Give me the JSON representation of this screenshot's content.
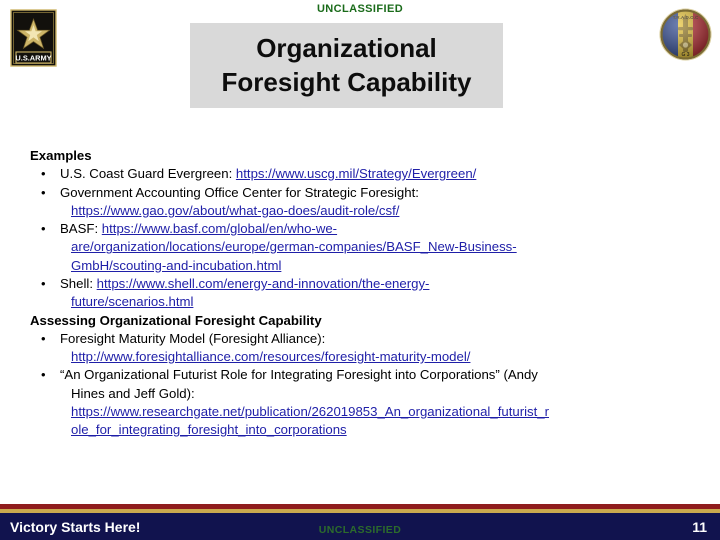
{
  "classification": {
    "top_label": "UNCLASSIFIED",
    "bottom_label": "UNCLASSIFIED",
    "color": "#1a6b1a"
  },
  "logos": {
    "army_star": {
      "name": "us-army-star-logo",
      "wordmark": "U.S.ARMY",
      "gold": "#cdb568",
      "background": "#12100c"
    },
    "unit_emblem": {
      "name": "tradoc-roundel-emblem",
      "top_text": "T R A D O C",
      "bottom_text": "G 3",
      "band_left": "#26408b",
      "band_center": "#e5c02e",
      "band_right": "#b4232a"
    }
  },
  "title": {
    "line1": "Organizational",
    "line2": "Foresight Capability",
    "box_color": "#d9d9d9"
  },
  "content": {
    "link_color": "#1f1fa8",
    "sections": [
      {
        "heading": "Examples",
        "bullets": [
          {
            "lines": [
              {
                "parts": [
                  {
                    "text": "U.S. Coast Guard Evergreen: ",
                    "link": false
                  },
                  {
                    "text": "https://www.uscg.mil/Strategy/Evergreen/",
                    "link": true
                  }
                ]
              }
            ]
          },
          {
            "lines": [
              {
                "parts": [
                  {
                    "text": "Government Accounting Office Center for Strategic Foresight:",
                    "link": false
                  }
                ]
              },
              {
                "parts": [
                  {
                    "text": "https://www.gao.gov/about/what-gao-does/audit-role/csf/",
                    "link": true
                  }
                ]
              }
            ]
          },
          {
            "lines": [
              {
                "parts": [
                  {
                    "text": "BASF: ",
                    "link": false
                  },
                  {
                    "text": "https://www.basf.com/global/en/who-we-",
                    "link": true
                  }
                ]
              },
              {
                "parts": [
                  {
                    "text": "are/organization/locations/europe/german-companies/BASF_New-Business-",
                    "link": true
                  }
                ]
              },
              {
                "parts": [
                  {
                    "text": "GmbH/scouting-and-incubation.html",
                    "link": true
                  }
                ]
              }
            ]
          },
          {
            "lines": [
              {
                "parts": [
                  {
                    "text": "Shell: ",
                    "link": false
                  },
                  {
                    "text": "https://www.shell.com/energy-and-innovation/the-energy-",
                    "link": true
                  }
                ]
              },
              {
                "parts": [
                  {
                    "text": "future/scenarios.html",
                    "link": true
                  }
                ]
              }
            ]
          }
        ]
      },
      {
        "heading": "Assessing Organizational Foresight Capability",
        "bullets": [
          {
            "lines": [
              {
                "parts": [
                  {
                    "text": "Foresight Maturity Model (Foresight Alliance):",
                    "link": false
                  }
                ]
              },
              {
                "parts": [
                  {
                    "text": "http://www.foresightalliance.com/resources/foresight-maturity-model/",
                    "link": true
                  }
                ]
              }
            ]
          },
          {
            "lines": [
              {
                "parts": [
                  {
                    "text": "“An Organizational Futurist Role for Integrating Foresight into Corporations” (Andy",
                    "link": false
                  }
                ]
              },
              {
                "parts": [
                  {
                    "text": "Hines and Jeff Gold):",
                    "link": false
                  }
                ]
              },
              {
                "parts": [
                  {
                    "text": "https://www.researchgate.net/publication/262019853_An_organizational_futurist_r",
                    "link": true
                  }
                ]
              },
              {
                "parts": [
                  {
                    "text": "ole_for_integrating_foresight_into_corporations",
                    "link": true
                  }
                ]
              }
            ]
          }
        ]
      }
    ]
  },
  "footer": {
    "tagline": "Victory Starts Here!",
    "page_number": "11",
    "bar_color": "#11134e",
    "stripe_red": "#8f1c1c",
    "stripe_gold": "#c9a94e"
  }
}
